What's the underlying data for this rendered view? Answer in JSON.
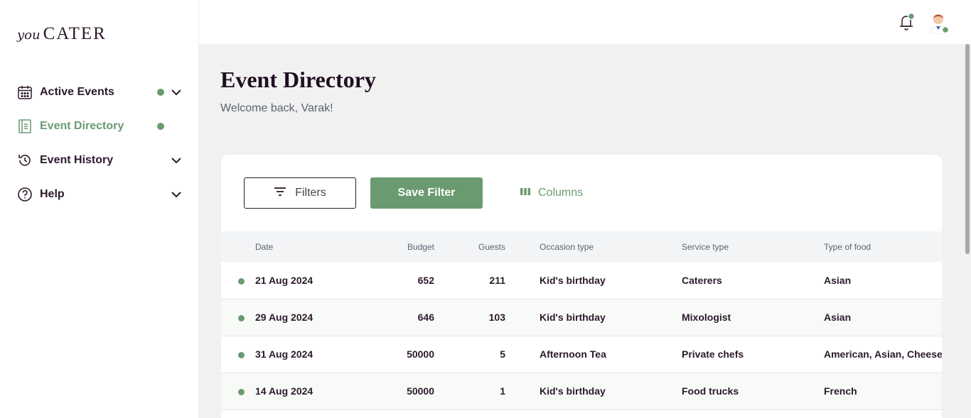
{
  "brand": {
    "logo_you": "you",
    "logo_cater": "CATER"
  },
  "sidebar": {
    "items": [
      {
        "label": "Active Events",
        "icon": "calendar-icon",
        "has_dot": true,
        "has_chevron": true
      },
      {
        "label": "Event Directory",
        "icon": "directory-icon",
        "has_dot": true,
        "has_chevron": false,
        "active": true
      },
      {
        "label": "Event History",
        "icon": "history-icon",
        "has_dot": false,
        "has_chevron": true
      },
      {
        "label": "Help",
        "icon": "help-icon",
        "has_dot": false,
        "has_chevron": true
      }
    ]
  },
  "header": {
    "notification_icon": "bell-icon",
    "avatar_icon": "user-avatar"
  },
  "main": {
    "title": "Event Directory",
    "welcome": "Welcome back, Varak!"
  },
  "toolbar": {
    "filters_label": "Filters",
    "save_filter_label": "Save Filter",
    "columns_label": "Columns"
  },
  "table": {
    "columns": [
      "Date",
      "Budget",
      "Guests",
      "Occasion type",
      "Service type",
      "Type of food"
    ],
    "rows": [
      {
        "date": "21 Aug 2024",
        "budget": "652",
        "guests": "211",
        "occasion": "Kid's birthday",
        "service": "Caterers",
        "food": "Asian"
      },
      {
        "date": "29 Aug 2024",
        "budget": "646",
        "guests": "103",
        "occasion": "Kid's birthday",
        "service": "Mixologist",
        "food": "Asian"
      },
      {
        "date": "31 Aug 2024",
        "budget": "50000",
        "guests": "5",
        "occasion": "Afternoon Tea",
        "service": "Private chefs",
        "food": "American, Asian, Cheese"
      },
      {
        "date": "14 Aug 2024",
        "budget": "50000",
        "guests": "1",
        "occasion": "Kid's birthday",
        "service": "Food trucks",
        "food": "French"
      }
    ]
  },
  "colors": {
    "accent": "#6a9b70",
    "text": "#2b1a2b",
    "background": "#f1f1f1"
  }
}
